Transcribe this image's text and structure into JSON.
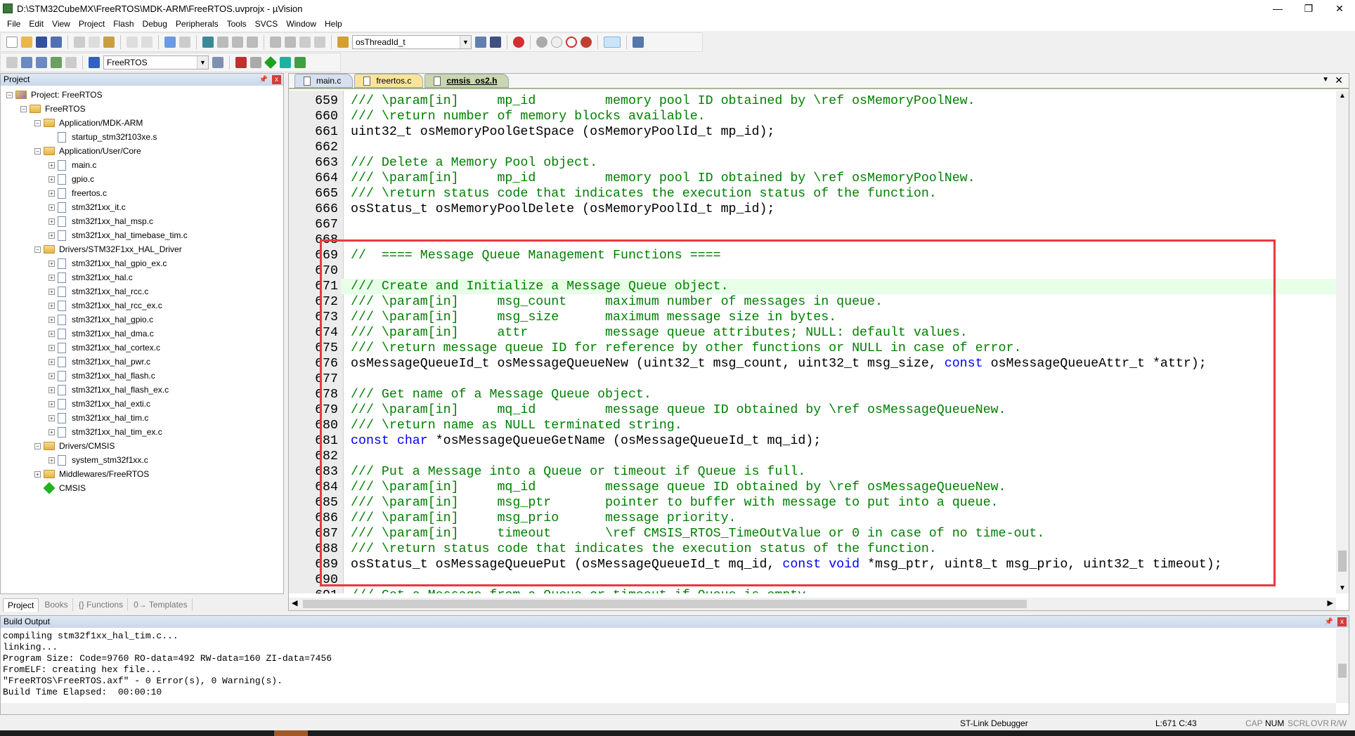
{
  "window": {
    "title": "D:\\STM32CubeMX\\FreeRTOS\\MDK-ARM\\FreeRTOS.uvprojx - µVision",
    "minimize": "—",
    "restore": "❐",
    "close": "✕"
  },
  "menu": [
    "File",
    "Edit",
    "View",
    "Project",
    "Flash",
    "Debug",
    "Peripherals",
    "Tools",
    "SVCS",
    "Window",
    "Help"
  ],
  "toolbar": {
    "find_combo": "osThreadId_t",
    "target_combo": "FreeRTOS"
  },
  "project_panel": {
    "title": "Project",
    "tree": [
      {
        "label": "Project: FreeRTOS",
        "level": 0,
        "type": "project",
        "toggle": "-"
      },
      {
        "label": "FreeRTOS",
        "level": 1,
        "type": "folder",
        "toggle": "-"
      },
      {
        "label": "Application/MDK-ARM",
        "level": 2,
        "type": "folder",
        "toggle": "-"
      },
      {
        "label": "startup_stm32f103xe.s",
        "level": 3,
        "type": "file",
        "toggle": ""
      },
      {
        "label": "Application/User/Core",
        "level": 2,
        "type": "folder",
        "toggle": "-"
      },
      {
        "label": "main.c",
        "level": 3,
        "type": "file",
        "toggle": "+"
      },
      {
        "label": "gpio.c",
        "level": 3,
        "type": "file",
        "toggle": "+"
      },
      {
        "label": "freertos.c",
        "level": 3,
        "type": "file",
        "toggle": "+"
      },
      {
        "label": "stm32f1xx_it.c",
        "level": 3,
        "type": "file",
        "toggle": "+"
      },
      {
        "label": "stm32f1xx_hal_msp.c",
        "level": 3,
        "type": "file",
        "toggle": "+"
      },
      {
        "label": "stm32f1xx_hal_timebase_tim.c",
        "level": 3,
        "type": "file",
        "toggle": "+"
      },
      {
        "label": "Drivers/STM32F1xx_HAL_Driver",
        "level": 2,
        "type": "folder",
        "toggle": "-"
      },
      {
        "label": "stm32f1xx_hal_gpio_ex.c",
        "level": 3,
        "type": "file",
        "toggle": "+"
      },
      {
        "label": "stm32f1xx_hal.c",
        "level": 3,
        "type": "file",
        "toggle": "+"
      },
      {
        "label": "stm32f1xx_hal_rcc.c",
        "level": 3,
        "type": "file",
        "toggle": "+"
      },
      {
        "label": "stm32f1xx_hal_rcc_ex.c",
        "level": 3,
        "type": "file",
        "toggle": "+"
      },
      {
        "label": "stm32f1xx_hal_gpio.c",
        "level": 3,
        "type": "file",
        "toggle": "+"
      },
      {
        "label": "stm32f1xx_hal_dma.c",
        "level": 3,
        "type": "file",
        "toggle": "+"
      },
      {
        "label": "stm32f1xx_hal_cortex.c",
        "level": 3,
        "type": "file",
        "toggle": "+"
      },
      {
        "label": "stm32f1xx_hal_pwr.c",
        "level": 3,
        "type": "file",
        "toggle": "+"
      },
      {
        "label": "stm32f1xx_hal_flash.c",
        "level": 3,
        "type": "file",
        "toggle": "+"
      },
      {
        "label": "stm32f1xx_hal_flash_ex.c",
        "level": 3,
        "type": "file",
        "toggle": "+"
      },
      {
        "label": "stm32f1xx_hal_exti.c",
        "level": 3,
        "type": "file",
        "toggle": "+"
      },
      {
        "label": "stm32f1xx_hal_tim.c",
        "level": 3,
        "type": "file",
        "toggle": "+"
      },
      {
        "label": "stm32f1xx_hal_tim_ex.c",
        "level": 3,
        "type": "file",
        "toggle": "+"
      },
      {
        "label": "Drivers/CMSIS",
        "level": 2,
        "type": "folder",
        "toggle": "-"
      },
      {
        "label": "system_stm32f1xx.c",
        "level": 3,
        "type": "file",
        "toggle": "+"
      },
      {
        "label": "Middlewares/FreeRTOS",
        "level": 2,
        "type": "folder",
        "toggle": "+"
      },
      {
        "label": "CMSIS",
        "level": 2,
        "type": "component",
        "toggle": ""
      }
    ],
    "tabs": [
      "Project",
      "Books",
      "{} Functions",
      "0→ Templates"
    ]
  },
  "editor": {
    "tabs": [
      {
        "label": "main.c",
        "bg": "#d6e0f0"
      },
      {
        "label": "freertos.c",
        "bg": "#fbe49a"
      },
      {
        "label": "cmsis_os2.h",
        "bg": "#c9d6b0",
        "active": true
      }
    ],
    "current_line": 671,
    "first_line": 659,
    "lines": [
      "/// \\param[in]     mp_id         memory pool ID obtained by \\ref osMemoryPoolNew.",
      "/// \\return number of memory blocks available.",
      "uint32_t osMemoryPoolGetSpace (osMemoryPoolId_t mp_id);",
      "",
      "/// Delete a Memory Pool object.",
      "/// \\param[in]     mp_id         memory pool ID obtained by \\ref osMemoryPoolNew.",
      "/// \\return status code that indicates the execution status of the function.",
      "osStatus_t osMemoryPoolDelete (osMemoryPoolId_t mp_id);",
      "",
      "",
      "//  ==== Message Queue Management Functions ====",
      "",
      "/// Create and Initialize a Message Queue object.",
      "/// \\param[in]     msg_count     maximum number of messages in queue.",
      "/// \\param[in]     msg_size      maximum message size in bytes.",
      "/// \\param[in]     attr          message queue attributes; NULL: default values.",
      "/// \\return message queue ID for reference by other functions or NULL in case of error.",
      "osMessageQueueId_t osMessageQueueNew (uint32_t msg_count, uint32_t msg_size, const osMessageQueueAttr_t *attr);",
      "",
      "/// Get name of a Message Queue object.",
      "/// \\param[in]     mq_id         message queue ID obtained by \\ref osMessageQueueNew.",
      "/// \\return name as NULL terminated string.",
      "const char *osMessageQueueGetName (osMessageQueueId_t mq_id);",
      "",
      "/// Put a Message into a Queue or timeout if Queue is full.",
      "/// \\param[in]     mq_id         message queue ID obtained by \\ref osMessageQueueNew.",
      "/// \\param[in]     msg_ptr       pointer to buffer with message to put into a queue.",
      "/// \\param[in]     msg_prio      message priority.",
      "/// \\param[in]     timeout       \\ref CMSIS_RTOS_TimeOutValue or 0 in case of no time-out.",
      "/// \\return status code that indicates the execution status of the function.",
      "osStatus_t osMessageQueuePut (osMessageQueueId_t mq_id, const void *msg_ptr, uint8_t msg_prio, uint32_t timeout);",
      "",
      "/// Get a Message from a Queue or timeout if Queue is empty."
    ],
    "colors": {
      "comment": "#008000",
      "keyword": "#0000ff",
      "highlight_box": "#e8393f",
      "current_line": "#e8ffe8"
    }
  },
  "build_output": {
    "title": "Build Output",
    "lines": [
      "compiling stm32f1xx_hal_tim.c...",
      "linking...",
      "Program Size: Code=9760 RO-data=492 RW-data=160 ZI-data=7456",
      "FromELF: creating hex file...",
      "\"FreeRTOS\\FreeRTOS.axf\" - 0 Error(s), 0 Warning(s).",
      "Build Time Elapsed:  00:00:10"
    ]
  },
  "status": {
    "debugger": "ST-Link Debugger",
    "position": "L:671 C:43",
    "cap": "CAP",
    "num": "NUM",
    "scrl": "SCRL",
    "ovr": "OVR",
    "rw": "R/W"
  }
}
